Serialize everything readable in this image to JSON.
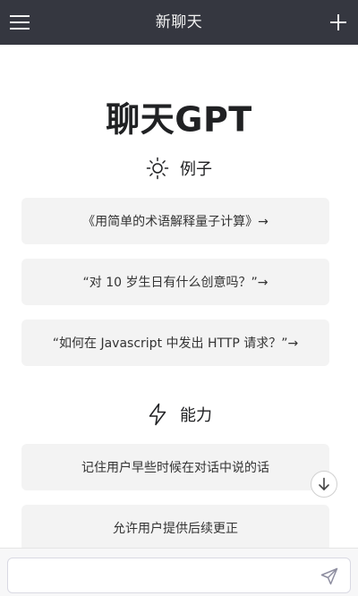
{
  "header": {
    "title": "新聊天",
    "menu_icon": "hamburger-menu-icon",
    "new_chat_icon": "plus-icon",
    "background": "#353740"
  },
  "brand": {
    "title": "聊天GPT"
  },
  "examples": {
    "heading": "例子",
    "icon": "sun-icon",
    "items": [
      "《用简单的术语解释量子计算》→",
      "“对 10 岁生日有什么创意吗？”→",
      "“如何在 Javascript 中发出 HTTP 请求？”→"
    ]
  },
  "capabilities": {
    "heading": "能力",
    "icon": "lightning-icon",
    "items": [
      "记住用户早些时候在对话中说的话",
      "允许用户提供后续更正"
    ]
  },
  "scroll_down": {
    "icon": "arrow-down-icon"
  },
  "composer": {
    "value": "",
    "placeholder": "",
    "send_icon": "send-icon"
  }
}
